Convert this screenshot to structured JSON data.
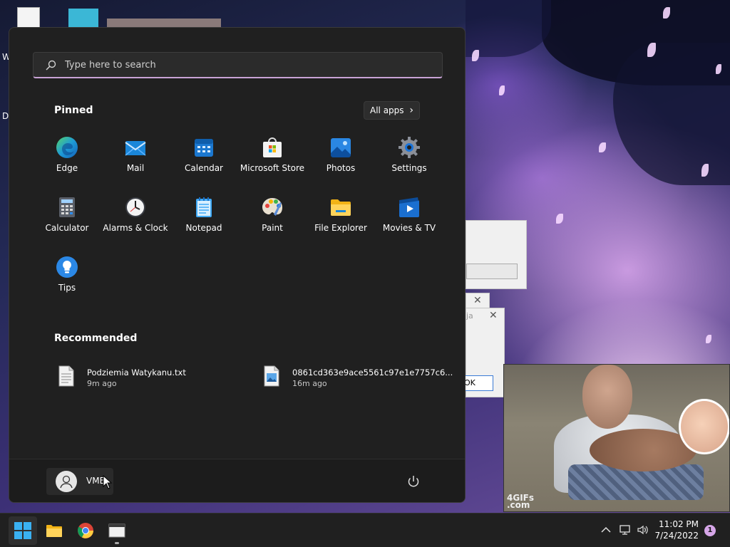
{
  "desktop": {
    "fragments": [
      "W",
      "Da"
    ],
    "dialog_fragment": "ja",
    "ok_fragment": "OK",
    "gif_watermark": "4GIFs\n.com"
  },
  "start_menu": {
    "search_placeholder": "Type here to search",
    "pinned_title": "Pinned",
    "all_apps_label": "All apps",
    "pinned_apps": [
      {
        "label": "Edge",
        "icon": "edge-icon"
      },
      {
        "label": "Mail",
        "icon": "mail-icon"
      },
      {
        "label": "Calendar",
        "icon": "calendar-icon"
      },
      {
        "label": "Microsoft Store",
        "icon": "store-icon"
      },
      {
        "label": "Photos",
        "icon": "photos-icon"
      },
      {
        "label": "Settings",
        "icon": "settings-icon"
      },
      {
        "label": "Calculator",
        "icon": "calculator-icon"
      },
      {
        "label": "Alarms & Clock",
        "icon": "clock-icon"
      },
      {
        "label": "Notepad",
        "icon": "notepad-icon"
      },
      {
        "label": "Paint",
        "icon": "paint-icon"
      },
      {
        "label": "File Explorer",
        "icon": "folder-icon"
      },
      {
        "label": "Movies & TV",
        "icon": "movies-icon"
      },
      {
        "label": "Tips",
        "icon": "tips-icon"
      }
    ],
    "recommended_title": "Recommended",
    "recommended": [
      {
        "name": "Podziemia Watykanu.txt",
        "time": "9m ago",
        "icon": "text-file-icon"
      },
      {
        "name": "0861cd363e9ace5561c97e1e7757c6...",
        "time": "16m ago",
        "icon": "image-file-icon"
      }
    ],
    "user_name": "VME"
  },
  "taskbar": {
    "time": "11:02 PM",
    "date": "7/24/2022",
    "notification_count": "1"
  },
  "colors": {
    "accent": "#c9a3d6",
    "menu_bg": "#202020",
    "taskbar_bg": "#202020"
  }
}
